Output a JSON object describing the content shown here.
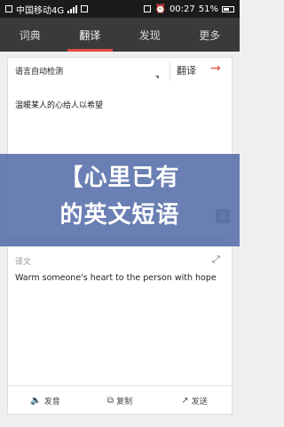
{
  "status": {
    "carrier": "中国移动4G",
    "time": "00:27",
    "battery": "51%"
  },
  "tabs": [
    {
      "label": "词典"
    },
    {
      "label": "翻译"
    },
    {
      "label": "发现"
    },
    {
      "label": "更多"
    }
  ],
  "translator": {
    "detect_label": "语言自动检测",
    "translate_button": "翻译",
    "source_text": "温暖某人的心给人以希望"
  },
  "result": {
    "label": "译文",
    "text": "Warm someone's heart to the person with hope"
  },
  "actions": [
    {
      "label": "发音",
      "icon": "speaker-icon"
    },
    {
      "label": "复制",
      "icon": "copy-icon"
    },
    {
      "label": "发送",
      "icon": "send-icon"
    }
  ],
  "overlay": {
    "line1": "【心里已有",
    "line2": "的英文短语"
  },
  "colors": {
    "accent": "#e04b3b",
    "tab_bar": "#3a3a3a",
    "overlay": "#526aa6"
  }
}
